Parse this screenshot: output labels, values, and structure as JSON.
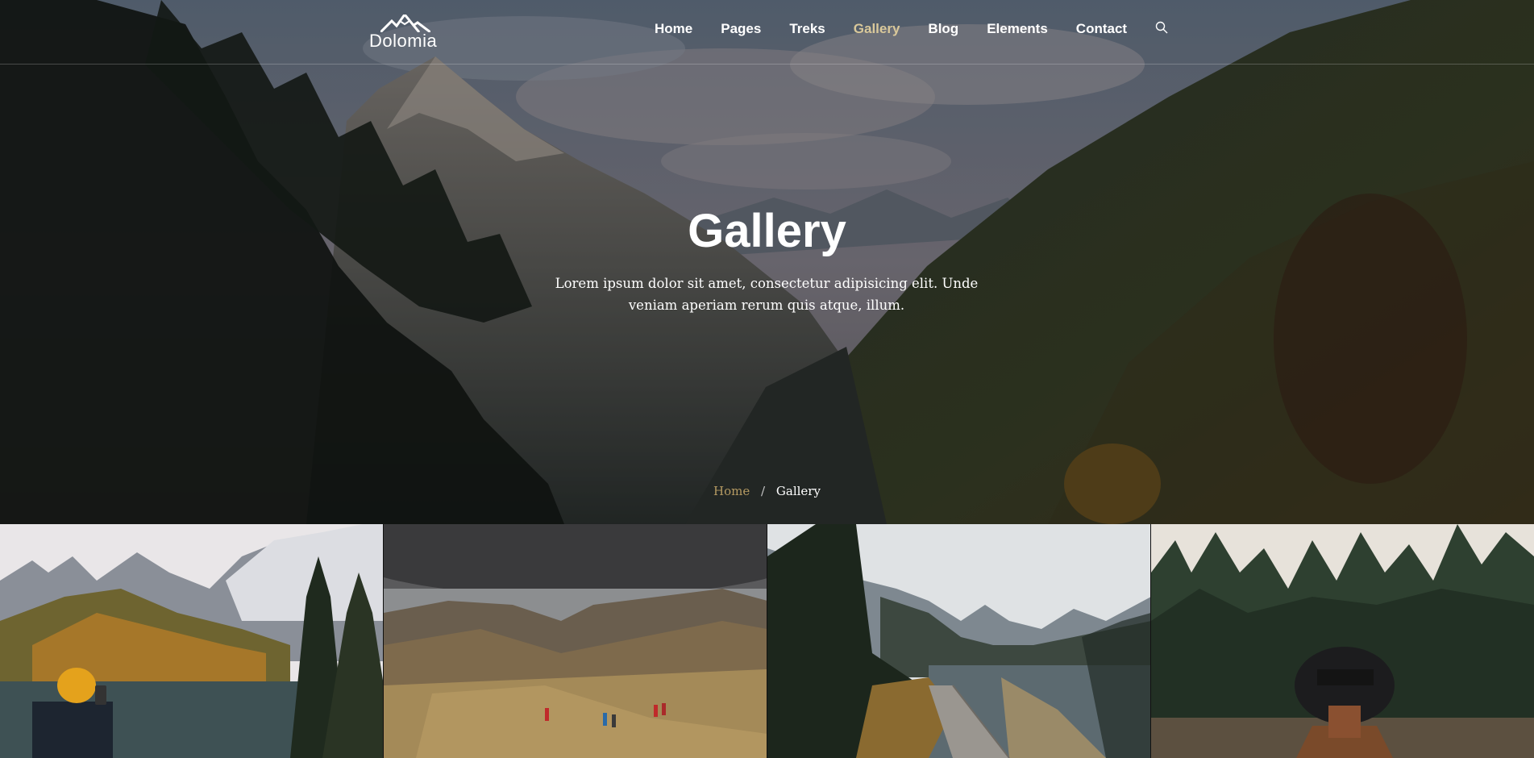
{
  "header": {
    "logo_text": "Dolomia",
    "nav": [
      {
        "label": "Home",
        "active": false
      },
      {
        "label": "Pages",
        "active": false
      },
      {
        "label": "Treks",
        "active": false
      },
      {
        "label": "Gallery",
        "active": true
      },
      {
        "label": "Blog",
        "active": false
      },
      {
        "label": "Elements",
        "active": false
      },
      {
        "label": "Contact",
        "active": false
      }
    ],
    "search_icon": "search-icon",
    "active_color": "#d9c89a"
  },
  "hero": {
    "title": "Gallery",
    "subtitle": "Lorem ipsum dolor sit amet, consectetur adipisicing elit. Unde veniam aperiam rerum quis atque, illum.",
    "breadcrumb": {
      "home": "Home",
      "separator": "/",
      "current": "Gallery"
    }
  },
  "gallery": {
    "tiles": [
      {
        "name": "gallery-image-hiker-lake"
      },
      {
        "name": "gallery-image-valley-hikers"
      },
      {
        "name": "gallery-image-boardwalk-river"
      },
      {
        "name": "gallery-image-forest-hat"
      }
    ]
  },
  "colors": {
    "accent": "#b59a62",
    "nav_active": "#d9c89a"
  }
}
